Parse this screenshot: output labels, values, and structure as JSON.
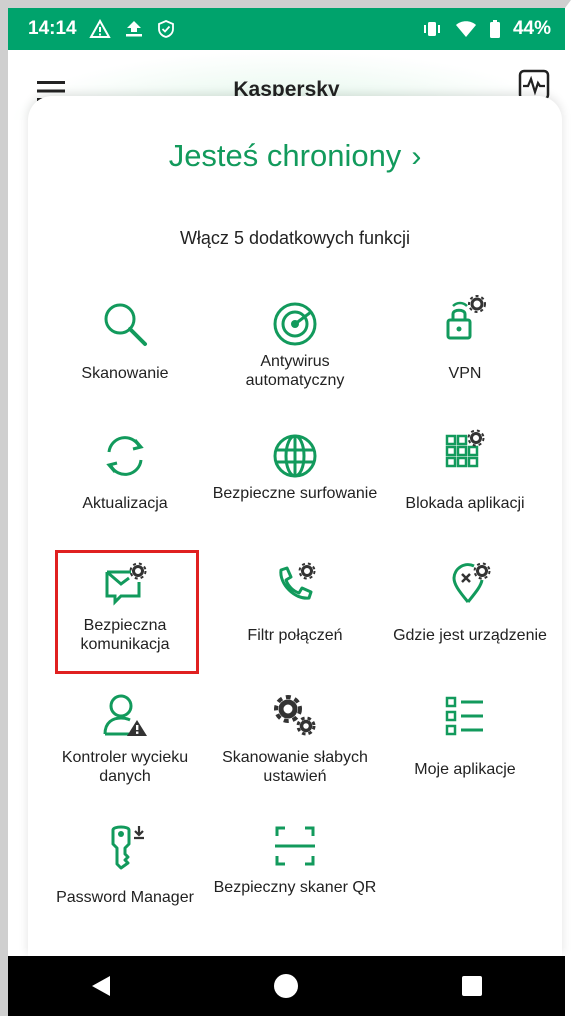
{
  "status_bar": {
    "time": "14:14",
    "battery": "44%",
    "icons": [
      "warning-icon",
      "upload-icon",
      "shield-icon",
      "vibrate-icon",
      "wifi-icon",
      "battery-icon"
    ]
  },
  "app_bar": {
    "title": "Kaspersky",
    "menu_icon": "hamburger-menu-icon",
    "action_icon": "activity-monitor-icon"
  },
  "header": {
    "protected_label": "Jesteś chroniony",
    "chevron": "›",
    "subtitle": "Włącz 5 dodatkowych funkcji"
  },
  "features": [
    {
      "label": "Skanowanie",
      "icon": "magnifier-icon"
    },
    {
      "label": "Antywirus automatyczny",
      "icon": "radar-icon"
    },
    {
      "label": "VPN",
      "icon": "lock-wifi-gear-icon"
    },
    {
      "label": "Aktualizacja",
      "icon": "refresh-icon"
    },
    {
      "label": "Bezpieczne surfowanie",
      "icon": "globe-icon"
    },
    {
      "label": "Blokada aplikacji",
      "icon": "grid-gear-icon"
    },
    {
      "label": "Bezpieczna komunikacja",
      "icon": "message-gear-icon"
    },
    {
      "label": "Filtr połączeń",
      "icon": "phone-gear-icon"
    },
    {
      "label": "Gdzie jest urządzenie",
      "icon": "location-gear-icon"
    },
    {
      "label": "Kontroler wycieku danych",
      "icon": "user-warning-icon"
    },
    {
      "label": "Skanowanie słabych ustawień",
      "icon": "gears-icon"
    },
    {
      "label": "Moje aplikacje",
      "icon": "list-icon"
    },
    {
      "label": "Password Manager",
      "icon": "key-icon"
    },
    {
      "label": "Bezpieczny skaner QR",
      "icon": "qr-scan-icon"
    }
  ],
  "colors": {
    "accent": "#129a5c",
    "status_bar": "#00a36c",
    "highlight": "#e02020"
  },
  "nav_bar": {
    "back_icon": "back-triangle-icon",
    "home_icon": "home-circle-icon",
    "recents_icon": "recents-square-icon"
  }
}
